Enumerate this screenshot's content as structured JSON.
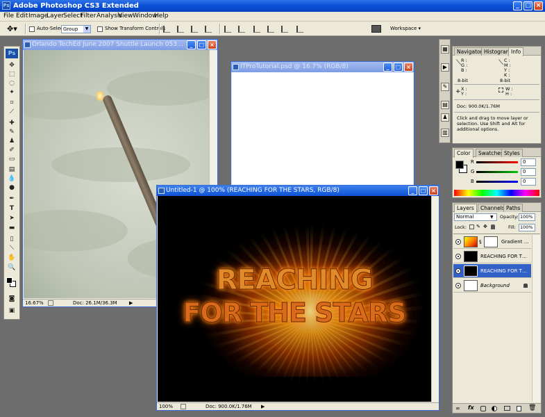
{
  "app": {
    "title": "Adobe Photoshop CS3 Extended",
    "logo": "Ps"
  },
  "menu": [
    "File",
    "Edit",
    "Image",
    "Layer",
    "Select",
    "Filter",
    "Analysis",
    "View",
    "Window",
    "Help"
  ],
  "options": {
    "auto_select_label": "Auto-Select:",
    "auto_select_value": "Group",
    "transform_label": "Show Transform Controls",
    "workspace_label": "Workspace ▾"
  },
  "toolbox": {
    "logo": "Ps"
  },
  "windows": {
    "shuttle": {
      "title": "Orlando TechEd June 2007 Shuttle Launch 053.psd @ ...",
      "zoom": "16.67%",
      "doc": "Doc: 26.1M/36.3M"
    },
    "itpro": {
      "title": "ITProTutorial.psd @ 16.7% (RGB/8)"
    },
    "untitled": {
      "title": "Untitled-1 @ 100% (REACHING FOR THE STARS, RGB/8)",
      "zoom": "100%",
      "doc": "Doc: 900.0K/1.76M",
      "line1": "REACHING",
      "line2": "FOR THE STARS"
    }
  },
  "info_panel": {
    "tabs": [
      "Navigator",
      "Histogram",
      "Info"
    ],
    "rgb": [
      "R :",
      "G :",
      "B :"
    ],
    "cmyk": [
      "C :",
      "M :",
      "Y :",
      "K :"
    ],
    "bit_left": "8-bit",
    "bit_right": "8-bit",
    "xy": [
      "X :",
      "Y :"
    ],
    "wh": [
      "W :",
      "H :"
    ],
    "doc": "Doc: 900.0K/1.76M",
    "hint": "Click and drag to move layer or selection.  Use Shift and Alt for additional options."
  },
  "color_panel": {
    "tabs": [
      "Color",
      "Swatches",
      "Styles"
    ],
    "r": "R",
    "g": "G",
    "b": "B",
    "r_value": "0",
    "g_value": "0",
    "b_value": "0"
  },
  "layers_panel": {
    "tabs": [
      "Layers",
      "Channels",
      "Paths"
    ],
    "blend_mode": "Normal",
    "opacity_label": "Opacity:",
    "opacity_value": "100%",
    "lock_label": "Lock:",
    "fill_label": "Fill:",
    "fill_value": "100%",
    "layers": [
      "Gradient Fill 1",
      "REACHING FOR THE S...",
      "REACHING FOR TH...",
      "Background"
    ]
  }
}
